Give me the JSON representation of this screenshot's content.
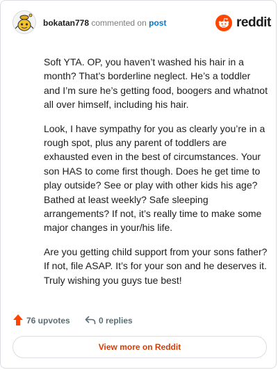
{
  "header": {
    "username": "bokatan778",
    "action": "commented on",
    "post_link": "post",
    "brand": "reddit",
    "colors": {
      "brand_orange": "#FF4500",
      "link_blue": "#0079D3"
    }
  },
  "comment": {
    "paragraphs": [
      "Soft YTA. OP, you haven’t washed his hair in a month? That’s borderline neglect. He’s a toddler and I’m sure he’s getting food, boogers and whatnot all over himself, including his hair.",
      "Look, I have sympathy for you as clearly you’re in a rough spot, plus any parent of toddlers are exhausted even in the best of circumstances. Your son HAS to come first though. Does he get time to play outside? See or play with other kids his age? Bathed at least weekly? Safe sleeping arrangements? If not, it’s really time to make some major changes in your/his life.",
      "Are you getting child support from your sons father? If not, file ASAP. It’s for your son and he deserves it. Truly wishing you guys tue best!"
    ]
  },
  "footer": {
    "upvotes": "76 upvotes",
    "replies": "0 replies",
    "view_more": "View more on Reddit",
    "icons": {
      "upvote": "upvote-arrow-icon",
      "reply": "reply-arrow-icon"
    }
  }
}
